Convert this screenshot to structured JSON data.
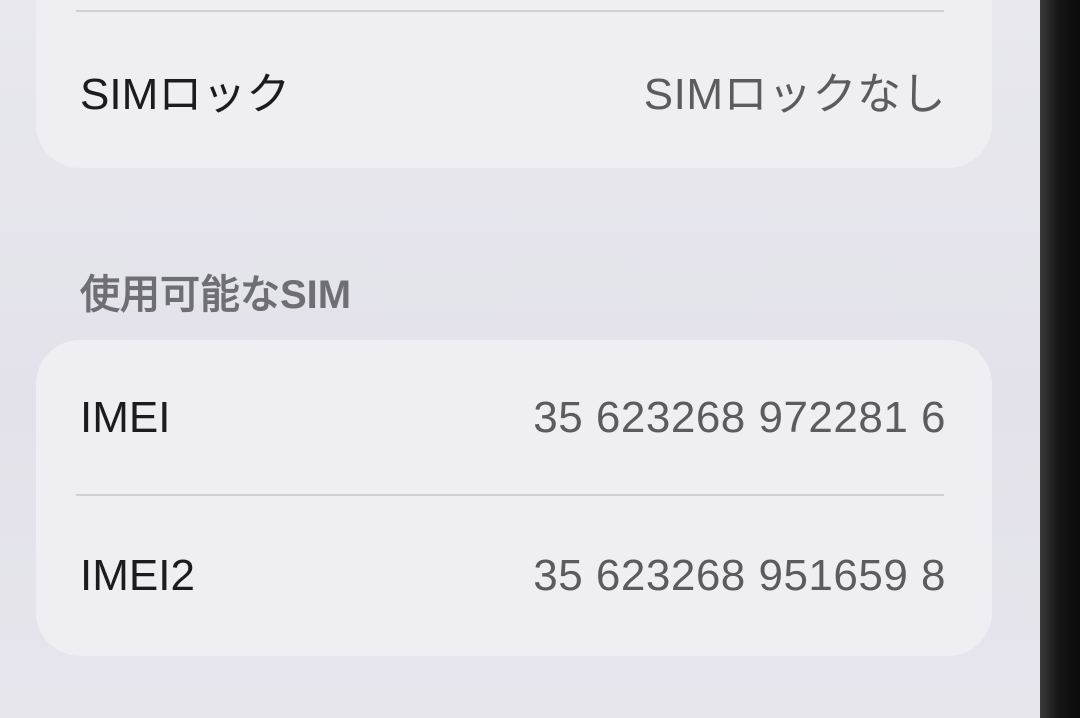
{
  "sim_lock": {
    "label": "SIMロック",
    "value": "SIMロックなし"
  },
  "available_sim": {
    "header": "使用可能なSIM",
    "rows": [
      {
        "label": "IMEI",
        "value": "35 623268 972281 6"
      },
      {
        "label": "IMEI2",
        "value": "35 623268 951659 8"
      }
    ]
  },
  "colors": {
    "background": "#e5e4eb",
    "card": "#efeff3",
    "label_text": "#1c1c1e",
    "value_text": "#5b5b60",
    "section_header": "#6e6e73",
    "divider": "#cfcfd4"
  }
}
